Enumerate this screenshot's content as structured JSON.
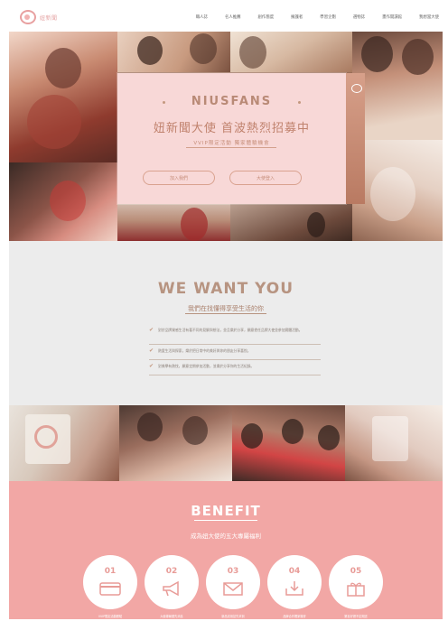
{
  "header": {
    "logo_text": "妞新聞",
    "menu": [
      "職人誌",
      "名人推薦",
      "創作態度",
      "擁護者",
      "學習企劃",
      "選物誌",
      "畫作開讀館",
      "我想當大使"
    ]
  },
  "hero": {
    "brand": "NIUSFANS",
    "headline": "妞新聞大使 首波熱烈招募中",
    "subline": "VVIP限定活動 獨家體驗機會",
    "button_primary": "加入我們",
    "button_secondary": "大使登入"
  },
  "want": {
    "title": "WE WANT YOU",
    "subtitle": "我們在找懂得享受生活的你",
    "requirements": [
      "對於品牌質感生活有著不同的見解與想法，並且樂於分享，願意擔任品牌大使並參加實體活動。",
      "熱愛生活與探索，樂於把日常中的美好與你的朋友分享喜悅。",
      "對美學有熱忱，願意定期參加活動，並樂於分享你的生活紀錄。"
    ]
  },
  "benefit": {
    "title": "BENEFIT",
    "subtitle": "成為妞大使的五大專屬福利",
    "items": [
      {
        "num": "01",
        "icon": "credit-card-icon",
        "caption": "VVIP限定活動體驗"
      },
      {
        "num": "02",
        "icon": "megaphone-icon",
        "caption": "大使專屬優先消息"
      },
      {
        "num": "03",
        "icon": "envelope-icon",
        "caption": "新品試用搶先拿到"
      },
      {
        "num": "04",
        "icon": "download-icon",
        "caption": "品牌合作獨家機會"
      },
      {
        "num": "05",
        "icon": "gift-icon",
        "caption": "驚喜好禮不定期送"
      }
    ]
  },
  "colors": {
    "accent_pink": "#f2a7a5",
    "card_pink": "#f8d8d7",
    "taupe": "#b79481",
    "gray_bg": "#ececec"
  }
}
